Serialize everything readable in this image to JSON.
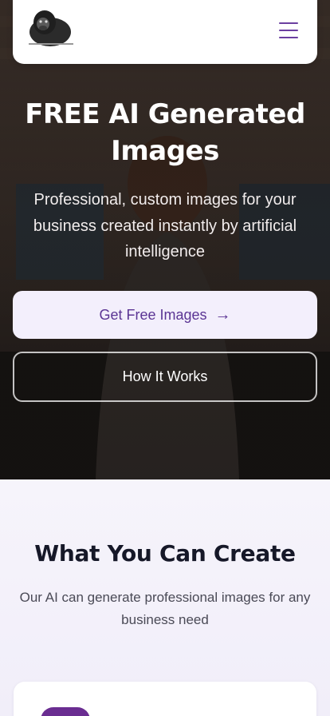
{
  "nav": {
    "logo_alt": "Gorilla logo",
    "menu_icon": "hamburger-menu-icon"
  },
  "hero": {
    "title": "FREE AI Generated Images",
    "subtitle": "Professional, custom images for your business created instantly by artificial intelligence",
    "primary_button": "Get Free Images",
    "primary_button_icon": "arrow-right-icon",
    "secondary_button": "How It Works"
  },
  "features": {
    "title": "What You Can Create",
    "subtitle": "Our AI can generate professional images for any business need"
  },
  "colors": {
    "accent": "#6b3fa0",
    "primary_button_bg": "#f3effc",
    "primary_button_text": "#5b3594",
    "heading_dark": "#161828",
    "card_icon_bg": "#6a2d91"
  }
}
